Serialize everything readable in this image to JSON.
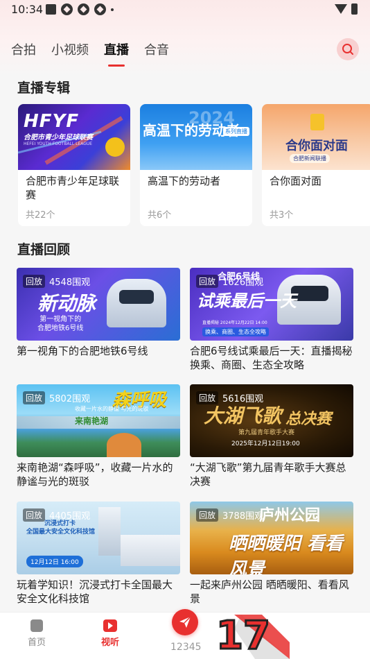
{
  "status_bar": {
    "time": "10:34"
  },
  "tabs": [
    {
      "label": "合拍",
      "active": false
    },
    {
      "label": "小视频",
      "active": false
    },
    {
      "label": "直播",
      "active": true
    },
    {
      "label": "合音",
      "active": false
    }
  ],
  "albums_section": {
    "title": "直播专辑",
    "items": [
      {
        "name": "合肥市青少年足球联赛",
        "count": "共22个",
        "cover_title": "HFYF",
        "cover_subtitle": "合肥市青少年足球联赛",
        "cover_en": "HEFEI YOUTH FOOTBALL LEAGUE"
      },
      {
        "name": "高温下的劳动者",
        "count": "共6个",
        "cover_title": "高温下的劳动者",
        "cover_tag": "系列直播",
        "cover_year": "2024"
      },
      {
        "name": "合你面对面",
        "count": "共3个",
        "cover_title": "合你面对面",
        "cover_sub": "合肥新闻联播"
      }
    ]
  },
  "replay_section": {
    "title": "直播回顾",
    "items": [
      {
        "tag": "回放",
        "views": "4548围观",
        "title": "第一视角下的合肥地铁6号线",
        "cover_big": "新动脉",
        "cover_small": "第一视角下的\n合肥地铁6号线"
      },
      {
        "tag": "回放",
        "views": "1626围观",
        "title": "合肥6号线试乘最后一天：直播揭秘换乘、商圈、生态全攻略",
        "cover_big": "试乘最后一天",
        "cover_small": "合肥6号线",
        "cover_meta": "直播揭秘  2024年12月22日 14:00",
        "cover_chips": "换乘、商圈、生态全攻略"
      },
      {
        "tag": "回放",
        "views": "5802围观",
        "title": "来南艳湖“森呼吸”，收藏一片水的静谧与光的斑驳",
        "cover_big": "森呼吸",
        "cover_small": "来南艳湖",
        "cover_sub": "收藏一片水的静谧  与光的斑驳"
      },
      {
        "tag": "回放",
        "views": "5616围观",
        "title": "“大湖飞歌”第九届青年歌手大赛总决赛",
        "cover_big": "大湖飞歌",
        "cover_final": "总决赛",
        "cover_sub": "第九届青年歌手大赛",
        "cover_date": "2025年12月12日19:00"
      },
      {
        "tag": "回放",
        "views": "4405围观",
        "title": "玩着学知识！沉浸式打卡全国最大安全文化科技馆",
        "cover_big": "沉浸式打卡",
        "cover_small": "全国最大安全文化科技馆",
        "cover_date": "12月12日 16:00"
      },
      {
        "tag": "回放",
        "views": "3788围观",
        "title": "一起来庐州公园 晒晒暖阳、看看风景",
        "cover_big": "庐州公园",
        "cover_small": "晒晒暖阳 看看风景"
      }
    ]
  },
  "bottom_nav": {
    "home": "首页",
    "listen": "视听",
    "hotline": "12345",
    "deco_number": "17"
  },
  "colors": {
    "accent": "#e8302f"
  },
  "icons": [
    "search-icon",
    "home-icon",
    "video-icon",
    "paper-plane-icon",
    "wifi-icon",
    "battery-icon"
  ]
}
